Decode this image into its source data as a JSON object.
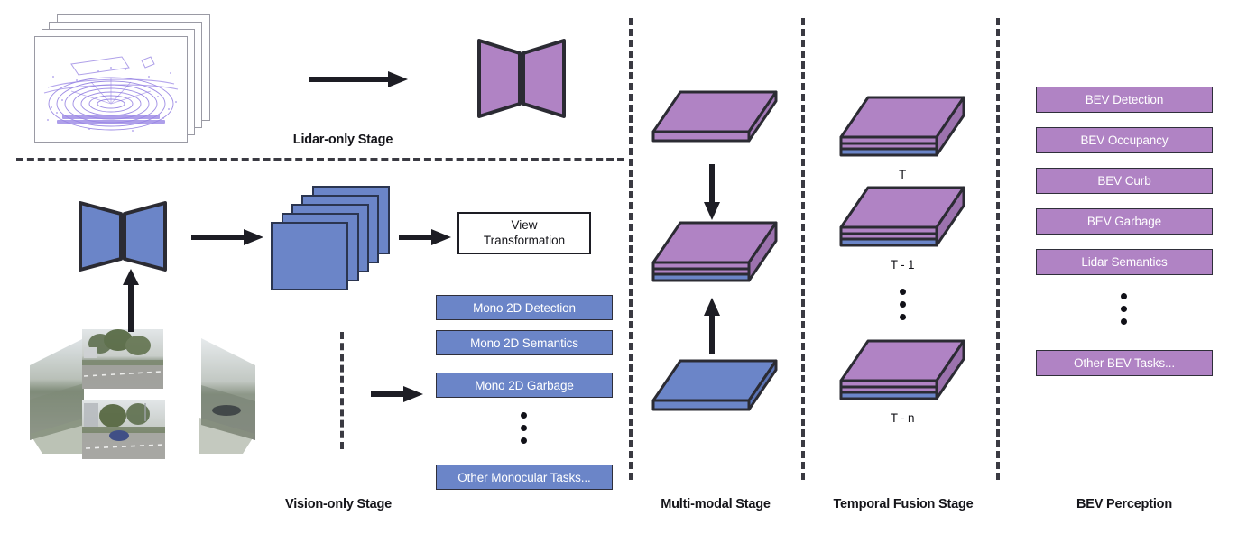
{
  "figure": {
    "title": "BEV perception multi-stage pipeline diagram",
    "colors": {
      "purple": "#b083c4",
      "blue": "#6b85c8",
      "outline": "#2f2f3a",
      "dash": "#3a3a42",
      "lidar_points": "#8d78e0",
      "white": "#ffffff"
    }
  },
  "stages": {
    "lidar_only": {
      "label": "Lidar-only Stage",
      "input_name": "lidar-point-cloud-frames",
      "frame_count": 4,
      "backbone_name": "lidar-backbone-hourglass",
      "backbone_color": "#b083c4"
    },
    "vision_only": {
      "label": "Vision-only Stage",
      "input_name": "surround-camera-ring",
      "camera_count": 6,
      "backbone_name": "image-backbone-hourglass",
      "backbone_color": "#6b85c8",
      "feature_stack_name": "image-feature-map-stack",
      "feature_stack_count": 5,
      "view_transformation": "View\nTransformation",
      "view_transformation_line1": "View",
      "view_transformation_line2": "Transformation",
      "tasks": [
        "Mono 2D Detection",
        "Mono 2D Semantics",
        "Mono 2D Garbage",
        "Other Monocular Tasks..."
      ]
    },
    "multi_modal": {
      "label": "Multi-modal Stage",
      "top_slab_name": "lidar-bev-feature-slab",
      "fused_slab_name": "fused-bev-feature-slab",
      "bottom_slab_name": "camera-bev-feature-slab"
    },
    "temporal_fusion": {
      "label": "Temporal Fusion Stage",
      "frames": [
        {
          "label": "T"
        },
        {
          "label": "T - 1"
        },
        {
          "label": "T - n"
        }
      ]
    },
    "bev_perception": {
      "label": "BEV Perception",
      "tasks": [
        "BEV Detection",
        "BEV Occupancy",
        "BEV Curb",
        "BEV Garbage",
        "Lidar Semantics",
        "Other BEV Tasks..."
      ]
    }
  }
}
